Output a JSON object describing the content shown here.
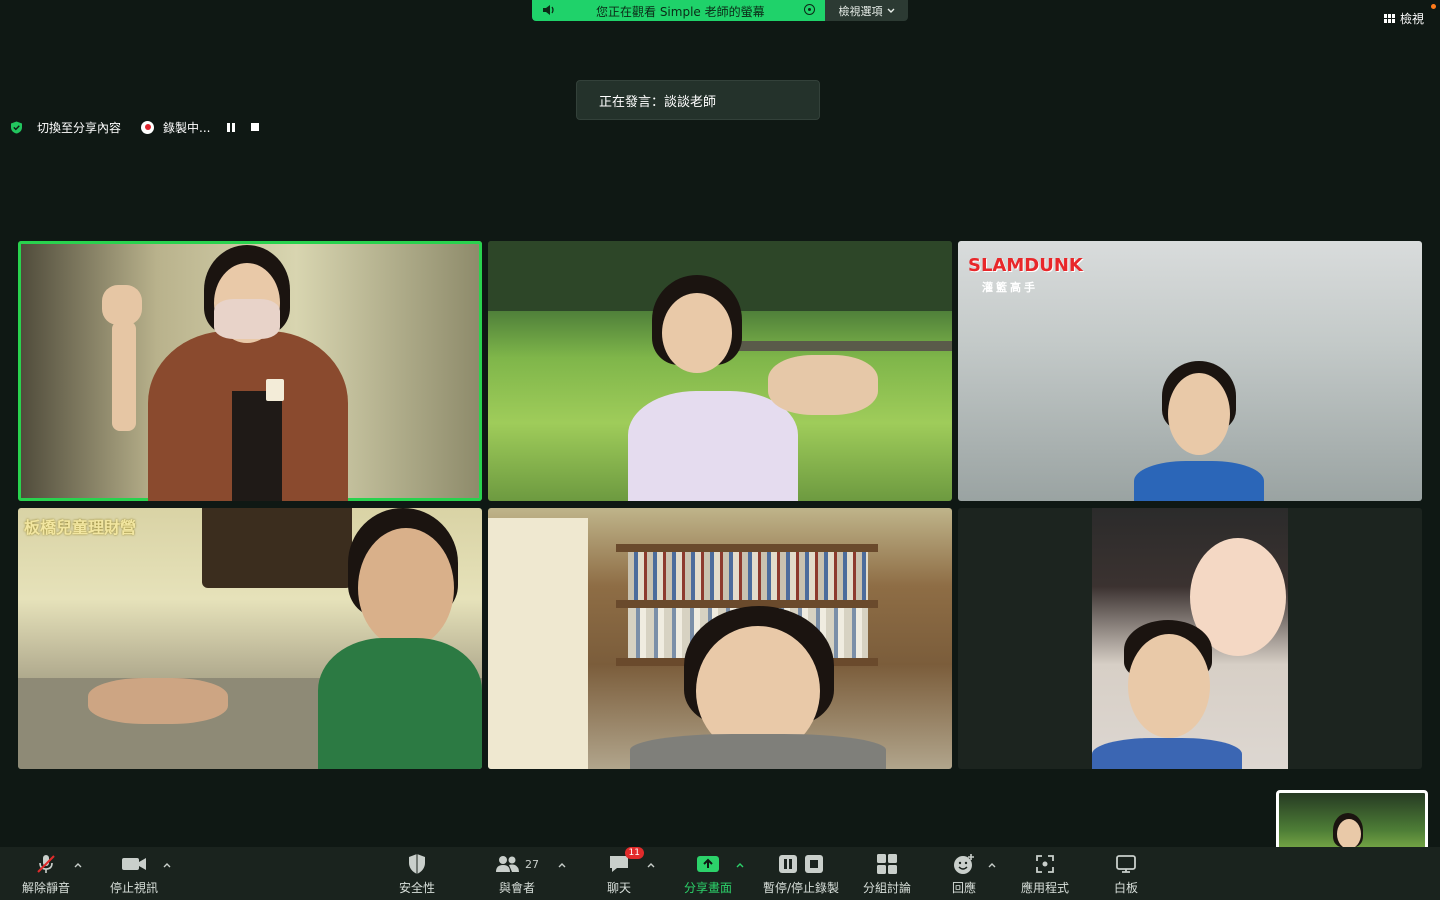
{
  "share_banner": {
    "text": "您正在觀看 Simple 老師的螢幕",
    "options_label": "檢視選項"
  },
  "top_right": {
    "view_label": "檢視"
  },
  "speaker": {
    "text": "正在發言：談談老師"
  },
  "status_bar": {
    "switch_share": "切換至分享內容",
    "recording": "錄製中..."
  },
  "tiles": {
    "t3_logo": "SLAMDUNK",
    "t3_sub": "灌籃高手",
    "t4_title": "板橋兒童理財營"
  },
  "toolbar": {
    "unmute": "解除靜音",
    "stop_video": "停止視訊",
    "security": "安全性",
    "participants": "與會者",
    "participants_count": "27",
    "chat": "聊天",
    "chat_badge": "11",
    "share": "分享畫面",
    "pause_record": "暫停/停止錄製",
    "breakout": "分組討論",
    "reactions": "回應",
    "apps": "應用程式",
    "whiteboard": "白板"
  },
  "colors": {
    "accent_green": "#2cd26a",
    "record_red": "#e0242e",
    "toolbar_bg": "#1a231e"
  }
}
